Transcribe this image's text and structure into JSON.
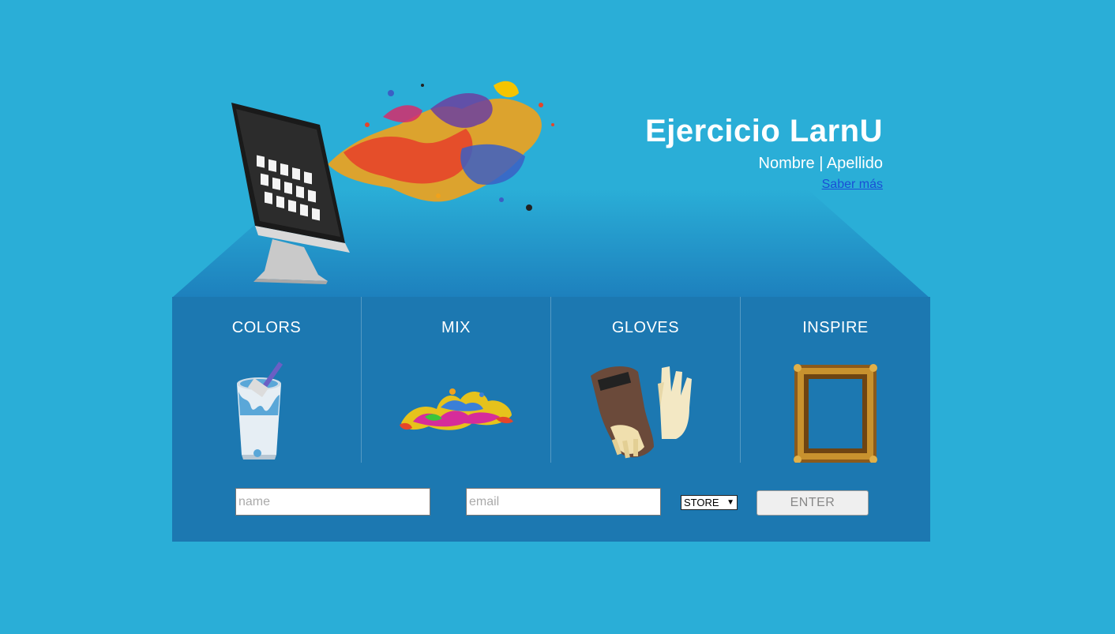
{
  "hero": {
    "title": "Ejercicio LarnU",
    "subtitle": "Nombre | Apellido",
    "link_text": "Saber más"
  },
  "categories": [
    {
      "label": "COLORS",
      "icon": "paint-bucket-icon"
    },
    {
      "label": "MIX",
      "icon": "paint-splash-icon"
    },
    {
      "label": "GLOVES",
      "icon": "gloves-icon"
    },
    {
      "label": "INSPIRE",
      "icon": "picture-frame-icon"
    }
  ],
  "form": {
    "name_placeholder": "name",
    "email_placeholder": "email",
    "select_value": "STORE",
    "submit_label": "ENTER"
  },
  "colors": {
    "background": "#2aaed7",
    "panel": "#1c78b1",
    "roof": "#1f86c0"
  }
}
